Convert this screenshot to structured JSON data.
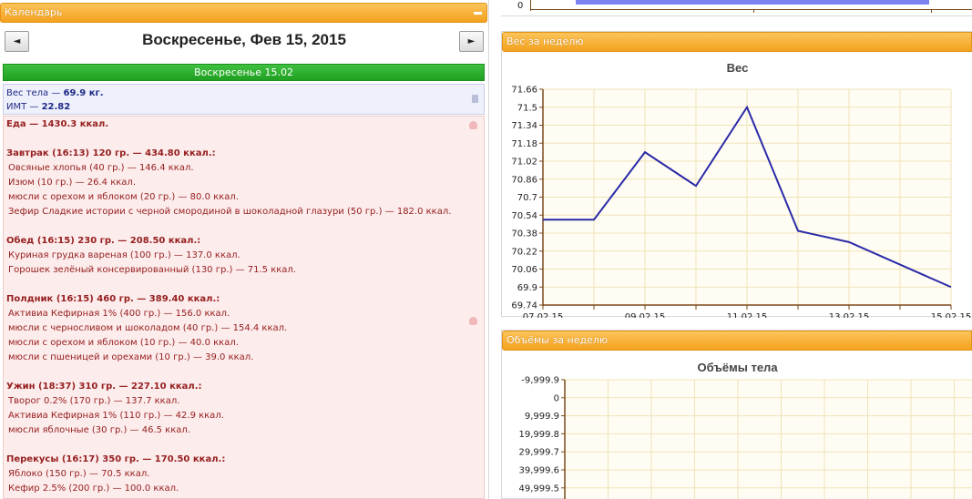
{
  "calendar": {
    "header": "Календарь",
    "date_title": "Воскресенье, Фев 15, 2015",
    "prev_label": "◄",
    "next_label": "►",
    "day_bar": "Воскресенье 15.02",
    "body": {
      "weight_label": "Вес тела — ",
      "weight_value": "69.9 кг.",
      "bmi_label": "ИМТ — ",
      "bmi_value": "22.82"
    },
    "food_lines": [
      {
        "text": "Еда — 1430.3 ккал.",
        "style": "bold"
      },
      {
        "text": "",
        "style": "blank"
      },
      {
        "text": "Завтрак (16:13) 120 гр. — 434.80 ккал.:",
        "style": "bold"
      },
      {
        "text": "Овсяные хлопья (40 гр.) — 146.4 ккал.",
        "style": "item"
      },
      {
        "text": "Изюм (10 гр.) — 26.4 ккал.",
        "style": "item"
      },
      {
        "text": "мюсли с орехом и яблоком (20 гр.) — 80.0 ккал.",
        "style": "item"
      },
      {
        "text": "Зефир Сладкие истории с черной смородиной в шоколадной глазури (50 гр.) — 182.0 ккал.",
        "style": "item"
      },
      {
        "text": "",
        "style": "blank"
      },
      {
        "text": "Обед (16:15) 230 гр. — 208.50 ккал.:",
        "style": "bold"
      },
      {
        "text": "Куриная грудка вареная (100 гр.) — 137.0 ккал.",
        "style": "item"
      },
      {
        "text": "Горошек зелёный консервированный (130 гр.) — 71.5 ккал.",
        "style": "item"
      },
      {
        "text": "",
        "style": "blank"
      },
      {
        "text": "Полдник (16:15) 460 гр. — 389.40 ккал.:",
        "style": "bold"
      },
      {
        "text": "Активиа Кефирная 1% (400 гр.) — 156.0 ккал.",
        "style": "item"
      },
      {
        "text": "мюсли с черносливом и шоколадом (40 гр.) — 154.4 ккал.",
        "style": "item"
      },
      {
        "text": "мюсли с орехом и яблоком (10 гр.) — 40.0 ккал.",
        "style": "item"
      },
      {
        "text": "мюсли с пшеницей и орехами (10 гр.) — 39.0 ккал.",
        "style": "item"
      },
      {
        "text": "",
        "style": "blank"
      },
      {
        "text": "Ужин (18:37) 310 гр. — 227.10 ккал.:",
        "style": "bold"
      },
      {
        "text": "Творог 0.2% (170 гр.) — 137.7 ккал.",
        "style": "item"
      },
      {
        "text": "Активиа Кефирная 1% (110 гр.) — 42.9 ккал.",
        "style": "item"
      },
      {
        "text": "мюсли яблочные (30 гр.) — 46.5 ккал.",
        "style": "item"
      },
      {
        "text": "",
        "style": "blank"
      },
      {
        "text": "Перекусы (16:17) 350 гр. — 170.50 ккал.:",
        "style": "bold"
      },
      {
        "text": "Яблоко (150 гр.) — 70.5 ккал.",
        "style": "item"
      },
      {
        "text": "Кефир 2.5% (200 гр.) — 100.0 ккал.",
        "style": "item"
      }
    ]
  },
  "top_chart": {
    "zero_label": "0"
  },
  "weight_panel": {
    "header": "Вес за неделю"
  },
  "volume_panel": {
    "header": "Объёмы за неделю"
  },
  "colors": {
    "accent_orange": "#f4a21f",
    "green_bar": "#20a020",
    "line_color": "#2a2aa8",
    "bar_color": "#7c83f0"
  },
  "chart_data": [
    {
      "type": "bar",
      "title": "",
      "note": "partially visible chart, only baseline visible",
      "ytick_labels": [
        "0"
      ]
    },
    {
      "type": "line",
      "title": "Вес",
      "x": [
        "07.02.15",
        "08.02.15",
        "09.02.15",
        "10.02.15",
        "11.02.15",
        "12.02.15",
        "13.02.15",
        "14.02.15",
        "15.02.15"
      ],
      "series": [
        {
          "values": [
            70.5,
            70.5,
            71.1,
            70.8,
            71.5,
            70.4,
            70.3,
            70.1,
            69.9
          ]
        }
      ],
      "xtick_labels": [
        "07.02.15",
        "09.02.15",
        "11.02.15",
        "13.02.15",
        "15.02.15"
      ],
      "ytick_labels": [
        "71.66",
        "71.5",
        "71.34",
        "71.18",
        "71.02",
        "70.86",
        "70.7",
        "70.54",
        "70.38",
        "70.22",
        "70.06",
        "69.9",
        "69.74"
      ],
      "ylim": [
        69.74,
        71.66
      ],
      "grid": true
    },
    {
      "type": "line",
      "title": "Объёмы тела",
      "series": [],
      "ytick_labels": [
        "-9,999.9",
        "0",
        "9,999.9",
        "19,999.8",
        "29,999.7",
        "39,999.6",
        "49,999.5"
      ],
      "grid": true
    }
  ]
}
